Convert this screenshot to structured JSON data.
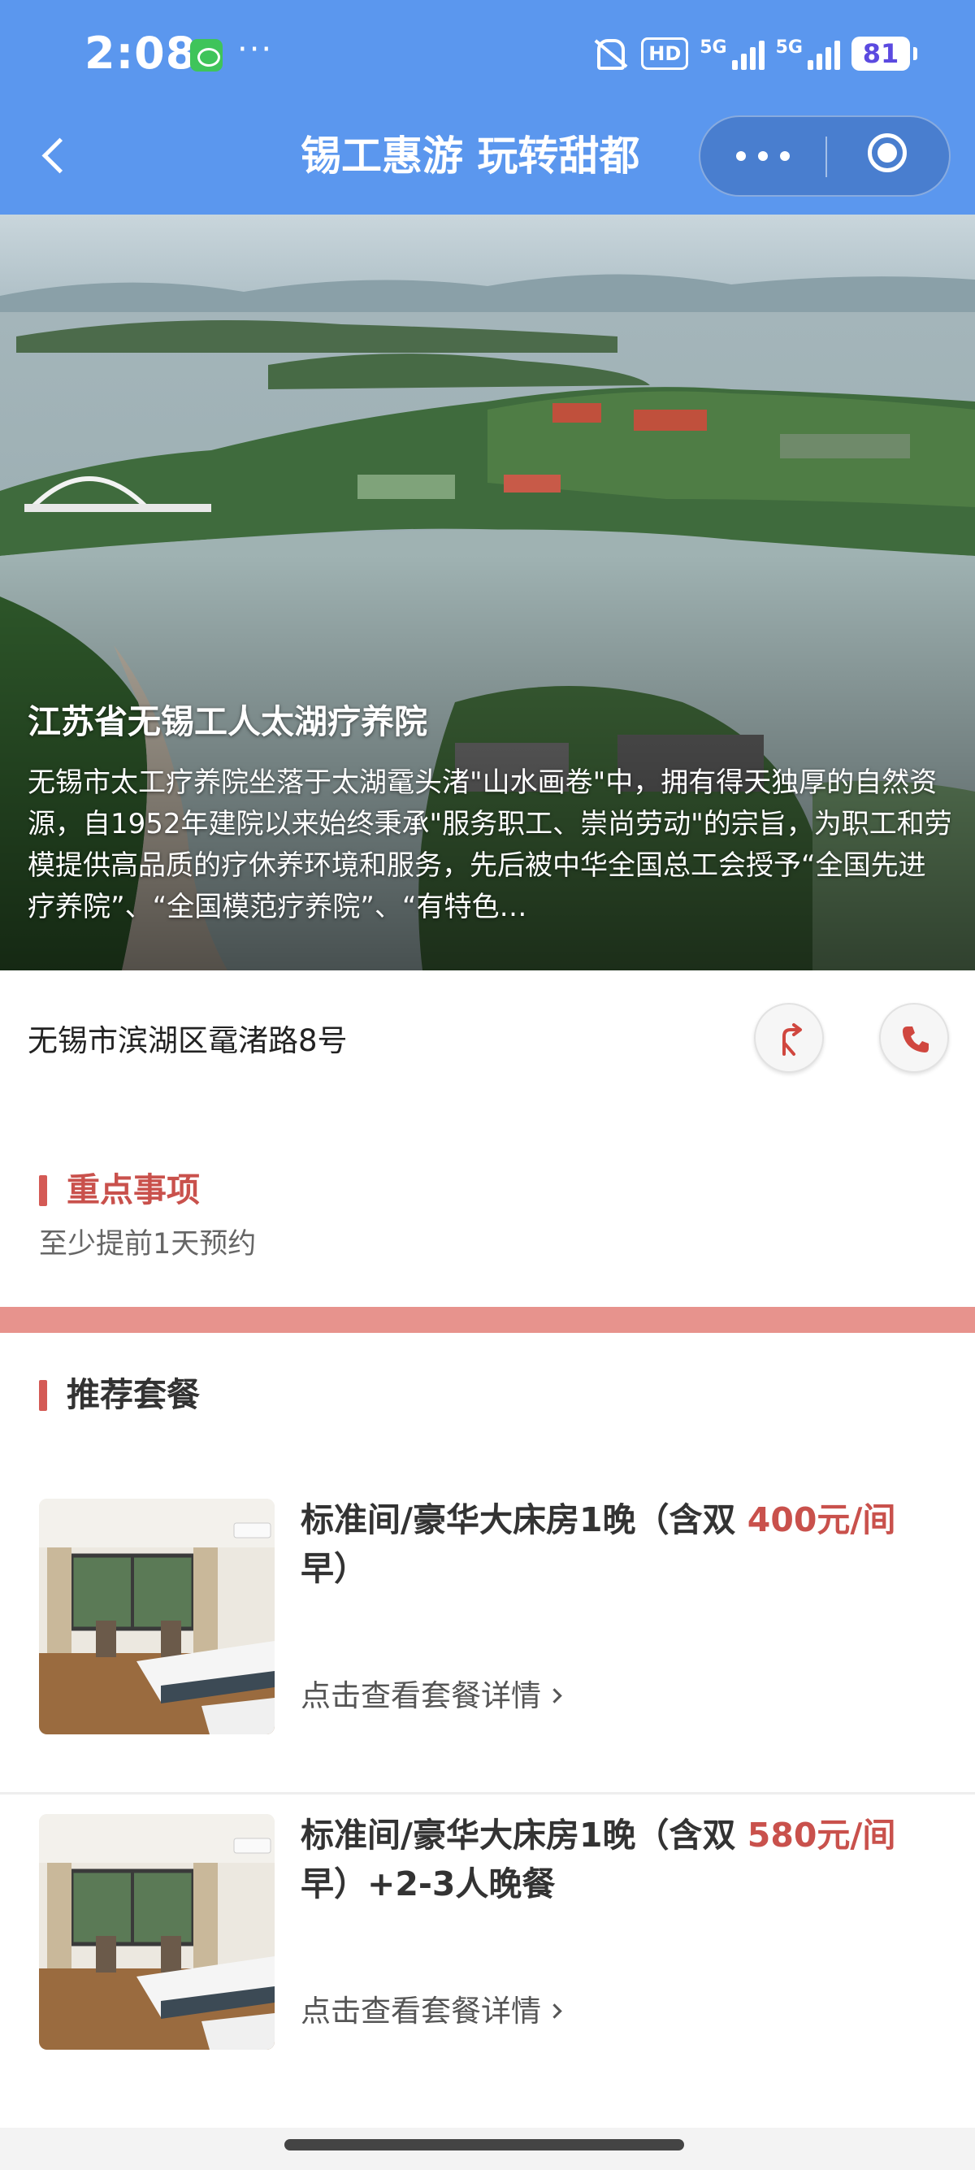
{
  "status_bar": {
    "time": "2:08",
    "more": "···",
    "hd": "HD",
    "network_1": "5G",
    "network_2": "5G",
    "battery": "81"
  },
  "header": {
    "title": "锡工惠游 玩转甜都",
    "bg_color": "#5b97ee"
  },
  "hero": {
    "title": "江苏省无锡工人太湖疗养院",
    "description": "无锡市太工疗养院坐落于太湖鼋头渚\"山水画卷\"中，拥有得天独厚的自然资源，自1952年建院以来始终秉承\"服务职工、崇尚劳动\"的宗旨，为职工和劳模提供高品质的疗休养环境和服务，先后被中华全国总工会授予“全国先进疗养院”、“全国模范疗养院”、“有特色…"
  },
  "address": {
    "text": "无锡市滨湖区鼋渚路8号",
    "nav_icon": "directions-icon",
    "phone_icon": "phone-icon"
  },
  "key_notes": {
    "title": "重点事项",
    "text": "至少提前1天预约"
  },
  "packages": {
    "title": "推荐套餐",
    "accent_color": "#c9514c",
    "items": [
      {
        "name": "标准间/豪华大床房1晚（含双早）",
        "price": "400元/间",
        "link": "点击查看套餐详情"
      },
      {
        "name": "标准间/豪华大床房1晚（含双早）+2-3人晚餐",
        "price": "580元/间",
        "link": "点击查看套餐详情"
      }
    ]
  }
}
